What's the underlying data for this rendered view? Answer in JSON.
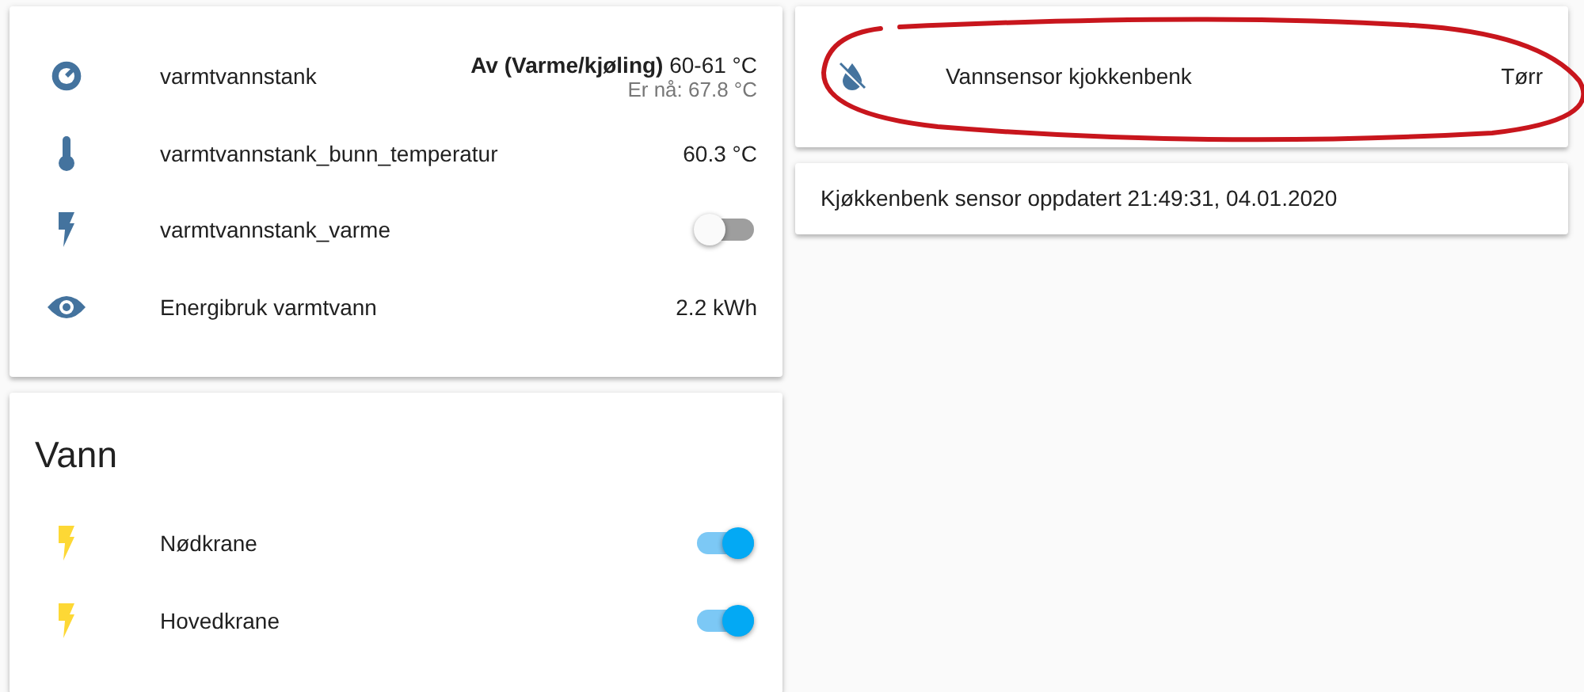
{
  "left_cards": [
    {
      "rows": [
        {
          "kind": "climate",
          "label": "varmtvannstank",
          "state": "Av (Varme/kjøling)",
          "target": "60-61 °C",
          "current": "Er nå: 67.8 °C"
        },
        {
          "kind": "sensor",
          "label": "varmtvannstank_bunn_temperatur",
          "value": "60.3 °C"
        },
        {
          "kind": "switch",
          "label": "varmtvannstank_varme",
          "on": false
        },
        {
          "kind": "sensor",
          "label": "Energibruk varmtvann",
          "value": "2.2 kWh"
        }
      ]
    },
    {
      "title": "Vann",
      "rows": [
        {
          "kind": "switch",
          "label": "Nødkrane",
          "on": true
        },
        {
          "kind": "switch",
          "label": "Hovedkrane",
          "on": true
        }
      ]
    }
  ],
  "right_cards": [
    {
      "rows": [
        {
          "kind": "sensor",
          "label": "Vannsensor kjokkenbenk",
          "value": "Tørr"
        }
      ],
      "circled": true
    },
    {
      "text": "Kjøkkenbenk sensor oppdatert 21:49:31, 04.01.2020"
    }
  ]
}
